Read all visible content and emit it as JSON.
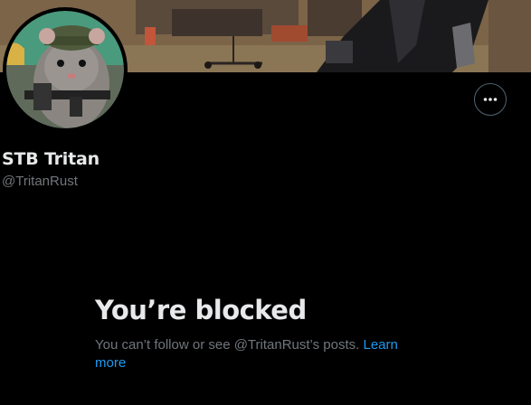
{
  "profile": {
    "display_name": "STB Tritan",
    "handle": "@TritanRust"
  },
  "actions": {
    "more_icon": "more-horizontal-icon"
  },
  "blocked": {
    "title": "You’re blocked",
    "message": "You can’t follow or see @TritanRust’s posts.",
    "link_label": "Learn more"
  },
  "colors": {
    "background": "#000000",
    "primary_text": "#e7e9ea",
    "secondary_text": "#71767b",
    "link": "#1d9bf0",
    "border": "#536471"
  }
}
